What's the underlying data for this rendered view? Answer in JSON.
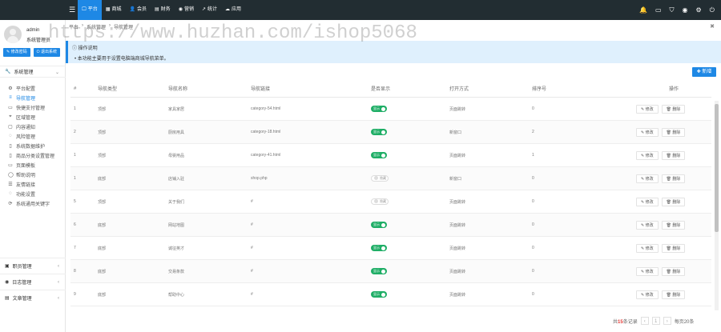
{
  "topbar": {
    "nav": [
      {
        "icon": "desktop-icon",
        "glyph": "🖵",
        "label": "平台"
      },
      {
        "icon": "shop-icon",
        "glyph": "▦",
        "label": "商城"
      },
      {
        "icon": "user-icon",
        "glyph": "👤",
        "label": "会员"
      },
      {
        "icon": "finance-icon",
        "glyph": "▤",
        "label": "财务"
      },
      {
        "icon": "marketing-icon",
        "glyph": "◉",
        "label": "营销"
      },
      {
        "icon": "stats-icon",
        "glyph": "↗",
        "label": "统计"
      },
      {
        "icon": "cloud-icon",
        "glyph": "☁",
        "label": "应用"
      }
    ]
  },
  "user": {
    "name": "admin",
    "role": "系统管理员",
    "edit_label": "修改密码",
    "logout_label": "退出系统"
  },
  "menu": {
    "system_label": "系统管理",
    "items": [
      {
        "icon": "gear-icon",
        "glyph": "⚙",
        "label": "平台配置"
      },
      {
        "icon": "nav-icon",
        "glyph": "≡",
        "label": "导航管理"
      },
      {
        "icon": "payment-icon",
        "glyph": "▭",
        "label": "快捷支付管理"
      },
      {
        "icon": "region-icon",
        "glyph": "⌖",
        "label": "区域管理"
      },
      {
        "icon": "message-icon",
        "glyph": "▢",
        "label": "内容通知"
      },
      {
        "icon": "chat-icon",
        "glyph": "◌",
        "label": "风险管理"
      },
      {
        "icon": "doc-icon",
        "glyph": "▯",
        "label": "系统数据维护"
      },
      {
        "icon": "file-icon",
        "glyph": "▯",
        "label": "商品分类设置管理"
      },
      {
        "icon": "template-icon",
        "glyph": "▭",
        "label": "页面模板"
      },
      {
        "icon": "account-icon",
        "glyph": "◯",
        "label": "帮助说明"
      },
      {
        "icon": "list-icon",
        "glyph": "☰",
        "label": "友情链接"
      },
      {
        "icon": "chat-icon",
        "glyph": "◌",
        "label": "功能设置"
      },
      {
        "icon": "refresh-icon",
        "glyph": "⟳",
        "label": "系统通用关键字"
      }
    ],
    "groups": [
      {
        "icon": "shield-icon",
        "glyph": "▣",
        "label": "职员管理"
      },
      {
        "icon": "eye-icon",
        "glyph": "◉",
        "label": "日志管理"
      },
      {
        "icon": "article-icon",
        "glyph": "▤",
        "label": "文章管理"
      }
    ]
  },
  "breadcrumb": [
    "平台",
    "系统管理",
    "导航管理"
  ],
  "info": {
    "title": "操作说明",
    "text": "本功能主要用于设置电脑端商城导航菜单。"
  },
  "add_label": "新增",
  "table": {
    "headers": [
      "#",
      "导航类型",
      "导航名称",
      "导航链接",
      "是否显示",
      "打开方式",
      "排序号",
      "操作"
    ],
    "rows": [
      {
        "num": "1",
        "type": "顶部",
        "name": "家具家居",
        "link": "category-54.html",
        "show": true,
        "show_label": "显示",
        "open": "页面跳转",
        "sort": "0"
      },
      {
        "num": "2",
        "type": "顶部",
        "name": "厨房用具",
        "link": "category-18.html",
        "show": true,
        "show_label": "显示",
        "open": "新窗口",
        "sort": "2"
      },
      {
        "num": "1",
        "type": "顶部",
        "name": "母婴用品",
        "link": "category-41.html",
        "show": true,
        "show_label": "显示",
        "open": "页面跳转",
        "sort": "1"
      },
      {
        "num": "1",
        "type": "底部",
        "name": "店铺入驻",
        "link": "shop.php",
        "show": false,
        "show_label": "隐藏",
        "open": "新窗口",
        "sort": "0"
      },
      {
        "num": "5",
        "type": "顶部",
        "name": "关于我们",
        "link": "#",
        "show": false,
        "show_label": "隐藏",
        "open": "页面跳转",
        "sort": "0"
      },
      {
        "num": "6",
        "type": "底部",
        "name": "网站地图",
        "link": "#",
        "show": true,
        "show_label": "显示",
        "open": "页面跳转",
        "sort": "0"
      },
      {
        "num": "7",
        "type": "底部",
        "name": "诚征英才",
        "link": "#",
        "show": true,
        "show_label": "显示",
        "open": "页面跳转",
        "sort": "0"
      },
      {
        "num": "8",
        "type": "底部",
        "name": "交易条款",
        "link": "#",
        "show": true,
        "show_label": "显示",
        "open": "页面跳转",
        "sort": "0"
      },
      {
        "num": "9",
        "type": "底部",
        "name": "帮助中心",
        "link": "#",
        "show": true,
        "show_label": "显示",
        "open": "页面跳转",
        "sort": "0"
      }
    ],
    "edit_label": "修改",
    "delete_label": "删除"
  },
  "pager": {
    "prefix": "共",
    "total": "15",
    "suffix": "条记录",
    "page": "1",
    "per_page": "每页20条"
  },
  "watermark": "https://www.huzhan.com/ishop5068"
}
